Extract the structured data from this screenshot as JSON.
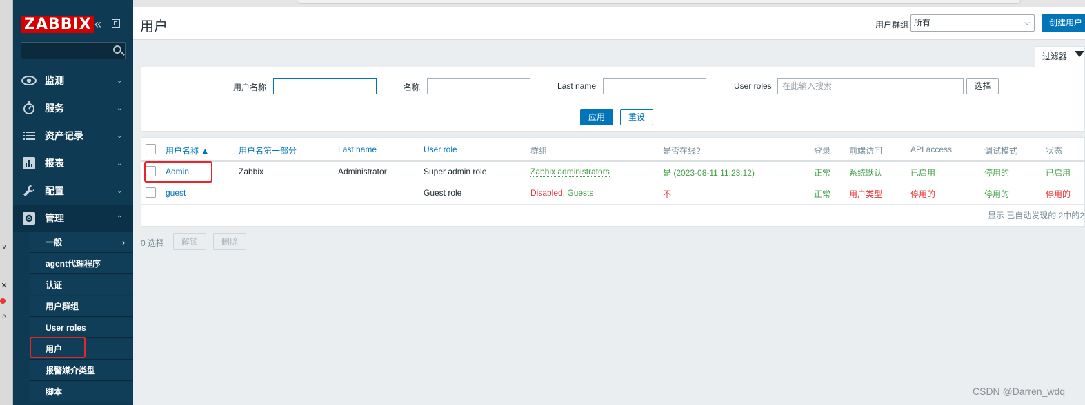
{
  "brand": {
    "logo": "ZABBIX",
    "accent": "#d40000",
    "sidebar_bg": "#0e3a54",
    "primary": "#0275b8"
  },
  "sidebar": {
    "collapse_icon": "«",
    "menu": [
      {
        "label": "监测",
        "icon": "eye-icon"
      },
      {
        "label": "服务",
        "icon": "stopwatch-icon"
      },
      {
        "label": "资产记录",
        "icon": "list-icon"
      },
      {
        "label": "报表",
        "icon": "bar-chart-icon"
      },
      {
        "label": "配置",
        "icon": "wrench-icon"
      },
      {
        "label": "管理",
        "icon": "gear-icon"
      }
    ],
    "submenu": [
      {
        "label": "一般"
      },
      {
        "label": "agent代理程序"
      },
      {
        "label": "认证"
      },
      {
        "label": "用户群组"
      },
      {
        "label": "User roles"
      },
      {
        "label": "用户"
      },
      {
        "label": "报警媒介类型"
      },
      {
        "label": "脚本"
      }
    ]
  },
  "header": {
    "title": "用户",
    "group_label": "用户群组",
    "group_value": "所有",
    "create_button": "创建用户"
  },
  "filter": {
    "tab_label": "过滤器",
    "username_label": "用户名称",
    "username_value": "",
    "name_label": "名称",
    "name_value": "",
    "lastname_label": "Last name",
    "lastname_value": "",
    "roles_label": "User roles",
    "roles_placeholder": "在此输入搜索",
    "select_button": "选择",
    "apply_button": "应用",
    "reset_button": "重设"
  },
  "table": {
    "columns": [
      "用户名称 ▲",
      "用户名第一部分",
      "Last name",
      "User role",
      "群组",
      "是否在线?",
      "登录",
      "前端访问",
      "API access",
      "调试模式",
      "状态"
    ],
    "rows": [
      {
        "username": "Admin",
        "name": "Zabbix",
        "lastname": "Administrator",
        "role": "Super admin role",
        "groups": [
          "Zabbix administrators"
        ],
        "online": "是 (2023-08-11 11:23:12)",
        "login": "正常",
        "frontend": "系统默认",
        "api": "已启用",
        "debug": "停用的",
        "status": "已启用"
      },
      {
        "username": "guest",
        "name": "",
        "lastname": "",
        "role": "Guest role",
        "groups": [
          "Disabled",
          ", ",
          "Guests"
        ],
        "online": "不",
        "login": "正常",
        "frontend": "用户类型",
        "api": "停用的",
        "debug": "停用的",
        "status": "停用的"
      }
    ],
    "footer": "显示 已自动发现的 2中的2"
  },
  "mass": {
    "selected": "0 选择",
    "unblock": "解锁",
    "delete": "删除"
  },
  "watermark": "CSDN @Darren_wdq",
  "left_strip": {
    "glyph_1": "v",
    "glyph_2": "✕",
    "glyph_3": "^"
  }
}
